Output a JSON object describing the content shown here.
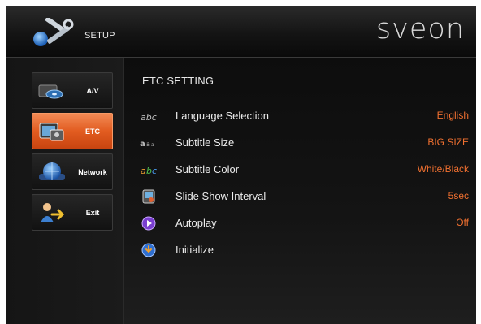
{
  "header": {
    "setup_label": "SETUP",
    "brand": "sveon"
  },
  "nav": {
    "items": [
      {
        "label": "A/V",
        "icon": "av-icon"
      },
      {
        "label": "ETC",
        "icon": "etc-icon",
        "active": true
      },
      {
        "label": "Network",
        "icon": "network-globe-icon"
      },
      {
        "label": "Exit",
        "icon": "exit-icon"
      }
    ]
  },
  "main": {
    "title": "ETC SETTING",
    "rows": [
      {
        "label": "Language Selection",
        "value": "English",
        "icon": "abc-text-icon"
      },
      {
        "label": "Subtitle Size",
        "value": "BIG SIZE",
        "icon": "text-size-icon"
      },
      {
        "label": "Subtitle  Color",
        "value": "White/Black",
        "icon": "abc-color-icon"
      },
      {
        "label": "Slide Show Interval",
        "value": "5sec",
        "icon": "slideshow-icon"
      },
      {
        "label": "Autoplay",
        "value": "Off",
        "icon": "play-icon"
      },
      {
        "label": "Initialize",
        "value": "",
        "icon": "initialize-icon"
      }
    ]
  },
  "colors": {
    "accent": "#e25c20",
    "value_text": "#f07030",
    "background": "#0b0b0b"
  }
}
